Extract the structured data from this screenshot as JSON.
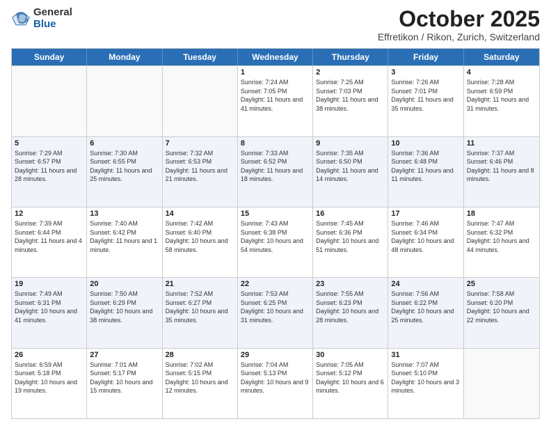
{
  "header": {
    "logo_general": "General",
    "logo_blue": "Blue",
    "month_title": "October 2025",
    "location": "Effretikon / Rikon, Zurich, Switzerland"
  },
  "weekdays": [
    "Sunday",
    "Monday",
    "Tuesday",
    "Wednesday",
    "Thursday",
    "Friday",
    "Saturday"
  ],
  "weeks": [
    [
      {
        "day": "",
        "sunrise": "",
        "sunset": "",
        "daylight": ""
      },
      {
        "day": "",
        "sunrise": "",
        "sunset": "",
        "daylight": ""
      },
      {
        "day": "",
        "sunrise": "",
        "sunset": "",
        "daylight": ""
      },
      {
        "day": "1",
        "sunrise": "Sunrise: 7:24 AM",
        "sunset": "Sunset: 7:05 PM",
        "daylight": "Daylight: 11 hours and 41 minutes."
      },
      {
        "day": "2",
        "sunrise": "Sunrise: 7:25 AM",
        "sunset": "Sunset: 7:03 PM",
        "daylight": "Daylight: 11 hours and 38 minutes."
      },
      {
        "day": "3",
        "sunrise": "Sunrise: 7:26 AM",
        "sunset": "Sunset: 7:01 PM",
        "daylight": "Daylight: 11 hours and 35 minutes."
      },
      {
        "day": "4",
        "sunrise": "Sunrise: 7:28 AM",
        "sunset": "Sunset: 6:59 PM",
        "daylight": "Daylight: 11 hours and 31 minutes."
      }
    ],
    [
      {
        "day": "5",
        "sunrise": "Sunrise: 7:29 AM",
        "sunset": "Sunset: 6:57 PM",
        "daylight": "Daylight: 11 hours and 28 minutes."
      },
      {
        "day": "6",
        "sunrise": "Sunrise: 7:30 AM",
        "sunset": "Sunset: 6:55 PM",
        "daylight": "Daylight: 11 hours and 25 minutes."
      },
      {
        "day": "7",
        "sunrise": "Sunrise: 7:32 AM",
        "sunset": "Sunset: 6:53 PM",
        "daylight": "Daylight: 11 hours and 21 minutes."
      },
      {
        "day": "8",
        "sunrise": "Sunrise: 7:33 AM",
        "sunset": "Sunset: 6:52 PM",
        "daylight": "Daylight: 11 hours and 18 minutes."
      },
      {
        "day": "9",
        "sunrise": "Sunrise: 7:35 AM",
        "sunset": "Sunset: 6:50 PM",
        "daylight": "Daylight: 11 hours and 14 minutes."
      },
      {
        "day": "10",
        "sunrise": "Sunrise: 7:36 AM",
        "sunset": "Sunset: 6:48 PM",
        "daylight": "Daylight: 11 hours and 11 minutes."
      },
      {
        "day": "11",
        "sunrise": "Sunrise: 7:37 AM",
        "sunset": "Sunset: 6:46 PM",
        "daylight": "Daylight: 11 hours and 8 minutes."
      }
    ],
    [
      {
        "day": "12",
        "sunrise": "Sunrise: 7:39 AM",
        "sunset": "Sunset: 6:44 PM",
        "daylight": "Daylight: 11 hours and 4 minutes."
      },
      {
        "day": "13",
        "sunrise": "Sunrise: 7:40 AM",
        "sunset": "Sunset: 6:42 PM",
        "daylight": "Daylight: 11 hours and 1 minute."
      },
      {
        "day": "14",
        "sunrise": "Sunrise: 7:42 AM",
        "sunset": "Sunset: 6:40 PM",
        "daylight": "Daylight: 10 hours and 58 minutes."
      },
      {
        "day": "15",
        "sunrise": "Sunrise: 7:43 AM",
        "sunset": "Sunset: 6:38 PM",
        "daylight": "Daylight: 10 hours and 54 minutes."
      },
      {
        "day": "16",
        "sunrise": "Sunrise: 7:45 AM",
        "sunset": "Sunset: 6:36 PM",
        "daylight": "Daylight: 10 hours and 51 minutes."
      },
      {
        "day": "17",
        "sunrise": "Sunrise: 7:46 AM",
        "sunset": "Sunset: 6:34 PM",
        "daylight": "Daylight: 10 hours and 48 minutes."
      },
      {
        "day": "18",
        "sunrise": "Sunrise: 7:47 AM",
        "sunset": "Sunset: 6:32 PM",
        "daylight": "Daylight: 10 hours and 44 minutes."
      }
    ],
    [
      {
        "day": "19",
        "sunrise": "Sunrise: 7:49 AM",
        "sunset": "Sunset: 6:31 PM",
        "daylight": "Daylight: 10 hours and 41 minutes."
      },
      {
        "day": "20",
        "sunrise": "Sunrise: 7:50 AM",
        "sunset": "Sunset: 6:29 PM",
        "daylight": "Daylight: 10 hours and 38 minutes."
      },
      {
        "day": "21",
        "sunrise": "Sunrise: 7:52 AM",
        "sunset": "Sunset: 6:27 PM",
        "daylight": "Daylight: 10 hours and 35 minutes."
      },
      {
        "day": "22",
        "sunrise": "Sunrise: 7:53 AM",
        "sunset": "Sunset: 6:25 PM",
        "daylight": "Daylight: 10 hours and 31 minutes."
      },
      {
        "day": "23",
        "sunrise": "Sunrise: 7:55 AM",
        "sunset": "Sunset: 6:23 PM",
        "daylight": "Daylight: 10 hours and 28 minutes."
      },
      {
        "day": "24",
        "sunrise": "Sunrise: 7:56 AM",
        "sunset": "Sunset: 6:22 PM",
        "daylight": "Daylight: 10 hours and 25 minutes."
      },
      {
        "day": "25",
        "sunrise": "Sunrise: 7:58 AM",
        "sunset": "Sunset: 6:20 PM",
        "daylight": "Daylight: 10 hours and 22 minutes."
      }
    ],
    [
      {
        "day": "26",
        "sunrise": "Sunrise: 6:59 AM",
        "sunset": "Sunset: 5:18 PM",
        "daylight": "Daylight: 10 hours and 19 minutes."
      },
      {
        "day": "27",
        "sunrise": "Sunrise: 7:01 AM",
        "sunset": "Sunset: 5:17 PM",
        "daylight": "Daylight: 10 hours and 15 minutes."
      },
      {
        "day": "28",
        "sunrise": "Sunrise: 7:02 AM",
        "sunset": "Sunset: 5:15 PM",
        "daylight": "Daylight: 10 hours and 12 minutes."
      },
      {
        "day": "29",
        "sunrise": "Sunrise: 7:04 AM",
        "sunset": "Sunset: 5:13 PM",
        "daylight": "Daylight: 10 hours and 9 minutes."
      },
      {
        "day": "30",
        "sunrise": "Sunrise: 7:05 AM",
        "sunset": "Sunset: 5:12 PM",
        "daylight": "Daylight: 10 hours and 6 minutes."
      },
      {
        "day": "31",
        "sunrise": "Sunrise: 7:07 AM",
        "sunset": "Sunset: 5:10 PM",
        "daylight": "Daylight: 10 hours and 3 minutes."
      },
      {
        "day": "",
        "sunrise": "",
        "sunset": "",
        "daylight": ""
      }
    ]
  ]
}
